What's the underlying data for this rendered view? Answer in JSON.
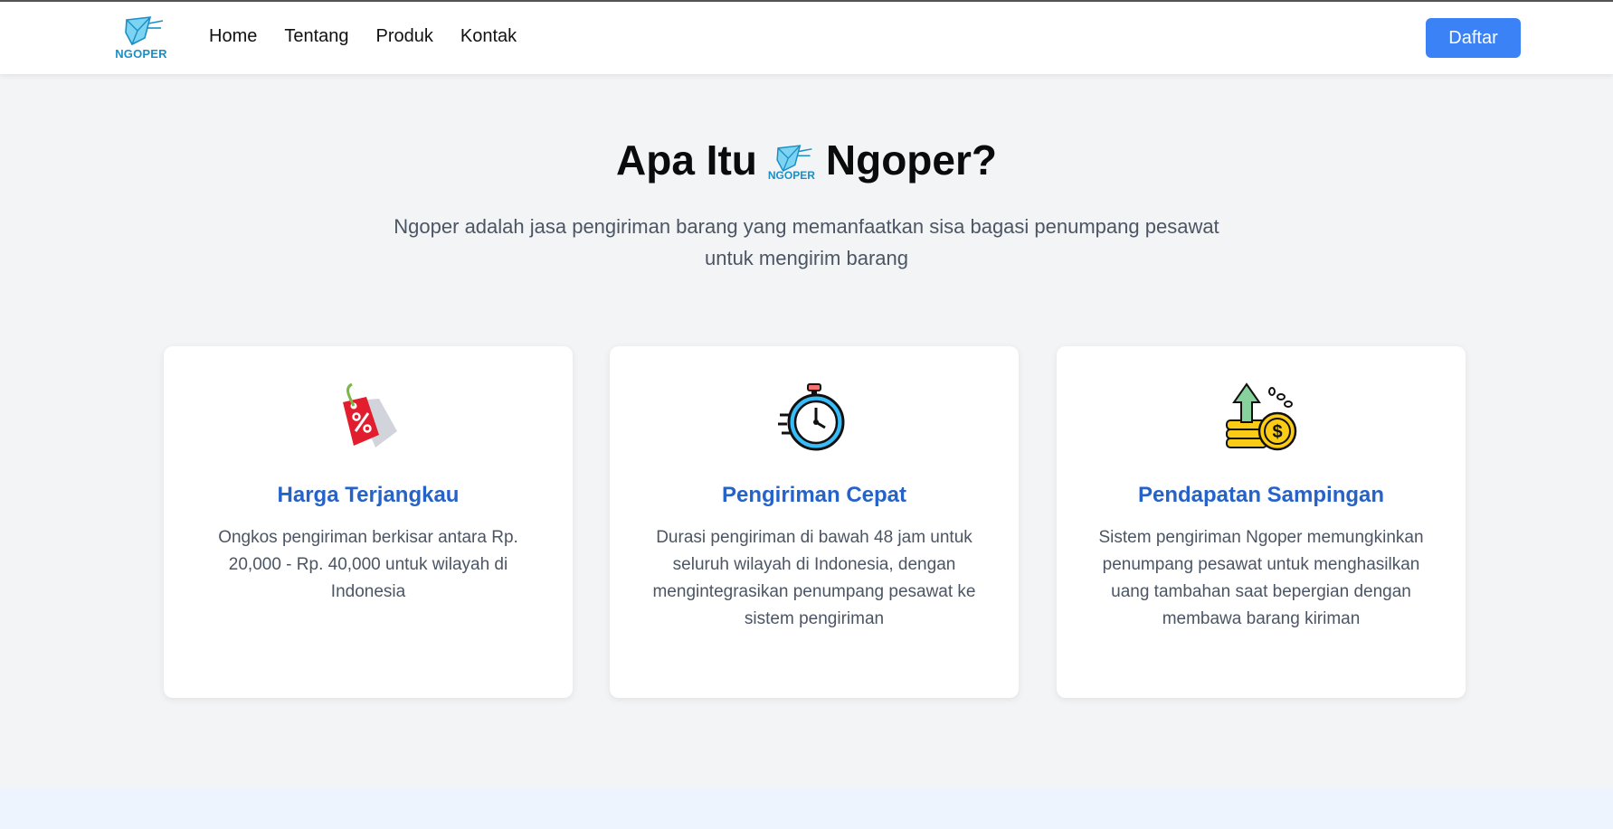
{
  "brand": {
    "logo_text": "NGOPER"
  },
  "nav": {
    "links": [
      "Home",
      "Tentang",
      "Produk",
      "Kontak"
    ],
    "cta_label": "Daftar"
  },
  "hero": {
    "title_before": "Apa Itu",
    "title_after": "Ngoper?",
    "description": "Ngoper adalah jasa pengiriman barang yang memanfaatkan sisa bagasi penumpang pesawat untuk mengirim barang"
  },
  "features": [
    {
      "icon": "discount-tag-icon",
      "title": "Harga Terjangkau",
      "text": "Ongkos pengiriman berkisar antara Rp. 20,000 - Rp. 40,000 untuk wilayah di Indonesia"
    },
    {
      "icon": "stopwatch-icon",
      "title": "Pengiriman Cepat",
      "text": "Durasi pengiriman di bawah 48 jam untuk seluruh wilayah di Indonesia, dengan mengintegrasikan penumpang pesawat ke sistem pengiriman"
    },
    {
      "icon": "money-growth-icon",
      "title": "Pendapatan Sampingan",
      "text": "Sistem pengiriman Ngoper memungkinkan penumpang pesawat untuk menghasilkan uang tambahan saat bepergian dengan membawa barang kiriman"
    }
  ],
  "colors": {
    "primary": "#3b82f6",
    "title_blue": "#2563c9",
    "background": "#f3f4f6",
    "logo": "#1a8fc6"
  }
}
